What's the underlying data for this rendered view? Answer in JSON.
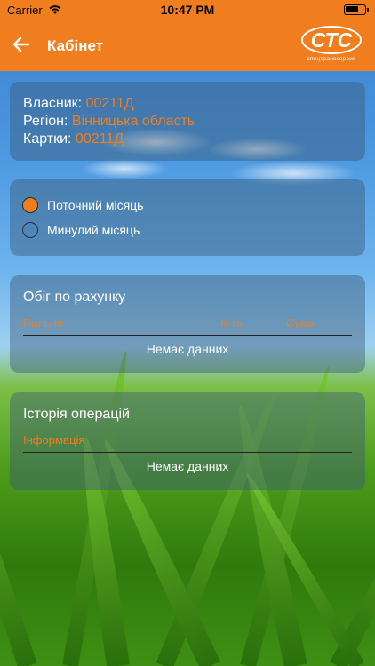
{
  "status_bar": {
    "carrier": "Carrier",
    "time": "10:47 PM",
    "battery_level": 0.6,
    "wifi_icon": "wifi-icon"
  },
  "nav": {
    "title": "Кабінет",
    "back_icon": "arrow-left-icon",
    "logo_text": "СТС",
    "logo_subtitle": "спецтранссервис"
  },
  "owner_info": {
    "owner_label": "Власник:",
    "owner_value": "00211Д",
    "region_label": "Регіон:",
    "region_value": "Вінницька область",
    "cards_label": "Картки:",
    "cards_value": "00211Д"
  },
  "period": {
    "options": [
      {
        "label": "Поточний місяць",
        "selected": true
      },
      {
        "label": "Минулий місяць",
        "selected": false
      }
    ]
  },
  "turnover": {
    "title": "Обіг по рахунку",
    "columns": [
      "Пальне",
      "К-ть",
      "Сума"
    ],
    "empty_text": "Немає данних"
  },
  "history": {
    "title": "Історія операцій",
    "columns": [
      "Інформація"
    ],
    "empty_text": "Немає данних"
  },
  "colors": {
    "accent": "#f07e1e",
    "card_bg": "rgba(60,90,120,0.45)",
    "text": "#ffffff"
  }
}
